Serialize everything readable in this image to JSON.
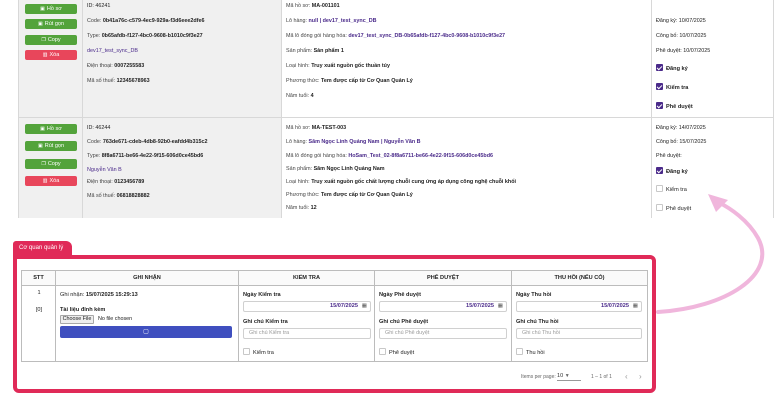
{
  "actions": {
    "ho_so": "Hồ sơ",
    "rut_gon": "Rút gọn",
    "copy": "Copy",
    "xoa": "Xóa"
  },
  "icons": {
    "folder": "folder-icon",
    "collapse": "collapse-icon",
    "copy": "copy-icon",
    "trash": "trash-icon",
    "calendar": "calendar-icon",
    "check": "check-icon"
  },
  "colors": {
    "green": "#53a33b",
    "red": "#e8465b",
    "panel": "#e02a58",
    "purple": "#4a2a8a",
    "blue": "#3f4fbf",
    "arrow": "#f0b6dc"
  },
  "records": [
    {
      "info": {
        "id": "ID: 46241",
        "code_label": "Code:",
        "code": "0b41a76c-c579-4ec9-929a-f3d6eee2dfe6",
        "type_label": "Type:",
        "type": "0b65afdb-f127-4bc0-9608-b1010c9f3e27",
        "owner": "dev17_test_sync_DB",
        "phone_label": "Điện thoại:",
        "phone": "0007255583",
        "tax_label": "Mã số thuế:",
        "tax": "12345678963"
      },
      "detail": {
        "ma_ho_so_label": "Mã hồ sơ:",
        "ma_ho_so": "MA-001101",
        "lo_hang_label": "Lô hàng:",
        "lo_hang": "null | dev17_test_sync_DB",
        "ma_lo_label": "Mã lô đóng gói hàng hóa:",
        "ma_lo": "dev17_test_sync_DB-0b65afdb-f127-4bc0-9608-b1010c9f3e27",
        "san_pham_label": "Sản phẩm:",
        "san_pham": "Sản phẩm 1",
        "loai_hinh_label": "Loại hình:",
        "loai_hinh": "Truy xuất nguồn gốc thuần túy",
        "phuong_thuc_label": "Phương thức:",
        "phuong_thuc": "Tem được cấp từ Cơ Quan Quản Lý",
        "nam_tuoi_label": "Năm tuổi:",
        "nam_tuoi": "4"
      },
      "status": {
        "dang_ky": "Đăng ký: 10/07/2025",
        "cong_bo": "Công bố: 10/07/2025",
        "phe_duyet": "Phê duyệt: 10/07/2025",
        "checks": [
          {
            "label": "Đăng ký",
            "checked": true
          },
          {
            "label": "Kiểm tra",
            "checked": true
          },
          {
            "label": "Phê duyệt",
            "checked": true
          }
        ]
      }
    },
    {
      "info": {
        "id": "ID: 46244",
        "code_label": "Code:",
        "code": "763de671-cdeb-4db8-92b0-eafdd4b315c2",
        "type_label": "Type:",
        "type": "8f8a6711-be66-4e22-9f15-606d0ce45bd6",
        "owner": "Nguyễn Văn B",
        "phone_label": "Điện thoại:",
        "phone": "0123456789",
        "tax_label": "Mã số thuế:",
        "tax": "06818828882"
      },
      "detail": {
        "ma_ho_so_label": "Mã hồ sơ:",
        "ma_ho_so": "MA-TEST-003",
        "lo_hang_label": "Lô hàng:",
        "lo_hang": "Sâm Ngọc Linh Quảng Nam | Nguyễn Văn B",
        "ma_lo_label": "Mã lô đóng gói hàng hóa:",
        "ma_lo": "HoSam_Test_02-8f8a6711-be66-4e22-9f15-606d0ce45bd6",
        "san_pham_label": "Sản phẩm:",
        "san_pham": "Sâm Ngọc Linh Quảng Nam",
        "loai_hinh_label": "Loại hình:",
        "loai_hinh": "Truy xuất nguồn gốc chất lượng chuỗi cung ứng áp dụng công nghệ chuỗi khối",
        "phuong_thuc_label": "Phương thức:",
        "phuong_thuc": "Tem được cấp từ Cơ Quan Quản Lý",
        "nam_tuoi_label": "Năm tuổi:",
        "nam_tuoi": "12"
      },
      "status": {
        "dang_ky": "Đăng ký: 14/07/2025",
        "cong_bo": "Công bố: 15/07/2025",
        "phe_duyet": "Phê duyệt:",
        "checks": [
          {
            "label": "Đăng ký",
            "checked": true
          },
          {
            "label": "Kiểm tra",
            "checked": false
          },
          {
            "label": "Phê duyệt",
            "checked": false
          }
        ]
      }
    }
  ],
  "panel": {
    "tab_label": "Cơ quan quản lý",
    "headers": [
      "STT",
      "GHI NHẬN",
      "KIỂM TRA",
      "PHÊ DUYỆT",
      "THU HỒI (NẾU CÓ)"
    ],
    "row": {
      "stt": "1",
      "stt_sub": "[0]",
      "ghi_nhan_label": "Ghi nhận:",
      "ghi_nhan_value": "15/07/2025 15:29:13",
      "tai_lieu_label": "Tài liệu đính kèm",
      "choose_file": "Choose File",
      "no_file": "No file chosen",
      "kiem_tra": {
        "date_label": "Ngày Kiểm tra",
        "date_value": "15/07/2025",
        "note_label": "Ghi chú Kiểm tra",
        "note_placeholder": "Ghi chú Kiểm tra",
        "check_label": "Kiểm tra"
      },
      "phe_duyet": {
        "date_label": "Ngày Phê duyệt",
        "date_value": "15/07/2025",
        "note_label": "Ghi chú Phê duyệt",
        "note_placeholder": "Ghi chú Phê duyệt",
        "check_label": "Phê duyệt"
      },
      "thu_hoi": {
        "date_label": "Ngày Thu hồi",
        "date_value": "15/07/2025",
        "note_label": "Ghi chú Thu hồi",
        "note_placeholder": "Ghi chú Thu hồi",
        "check_label": "Thu hồi"
      }
    },
    "pager": {
      "items_per_page_label": "Items per page:",
      "items_per_page": "10",
      "range": "1 – 1 of 1",
      "prev": "‹",
      "next": "›"
    }
  }
}
